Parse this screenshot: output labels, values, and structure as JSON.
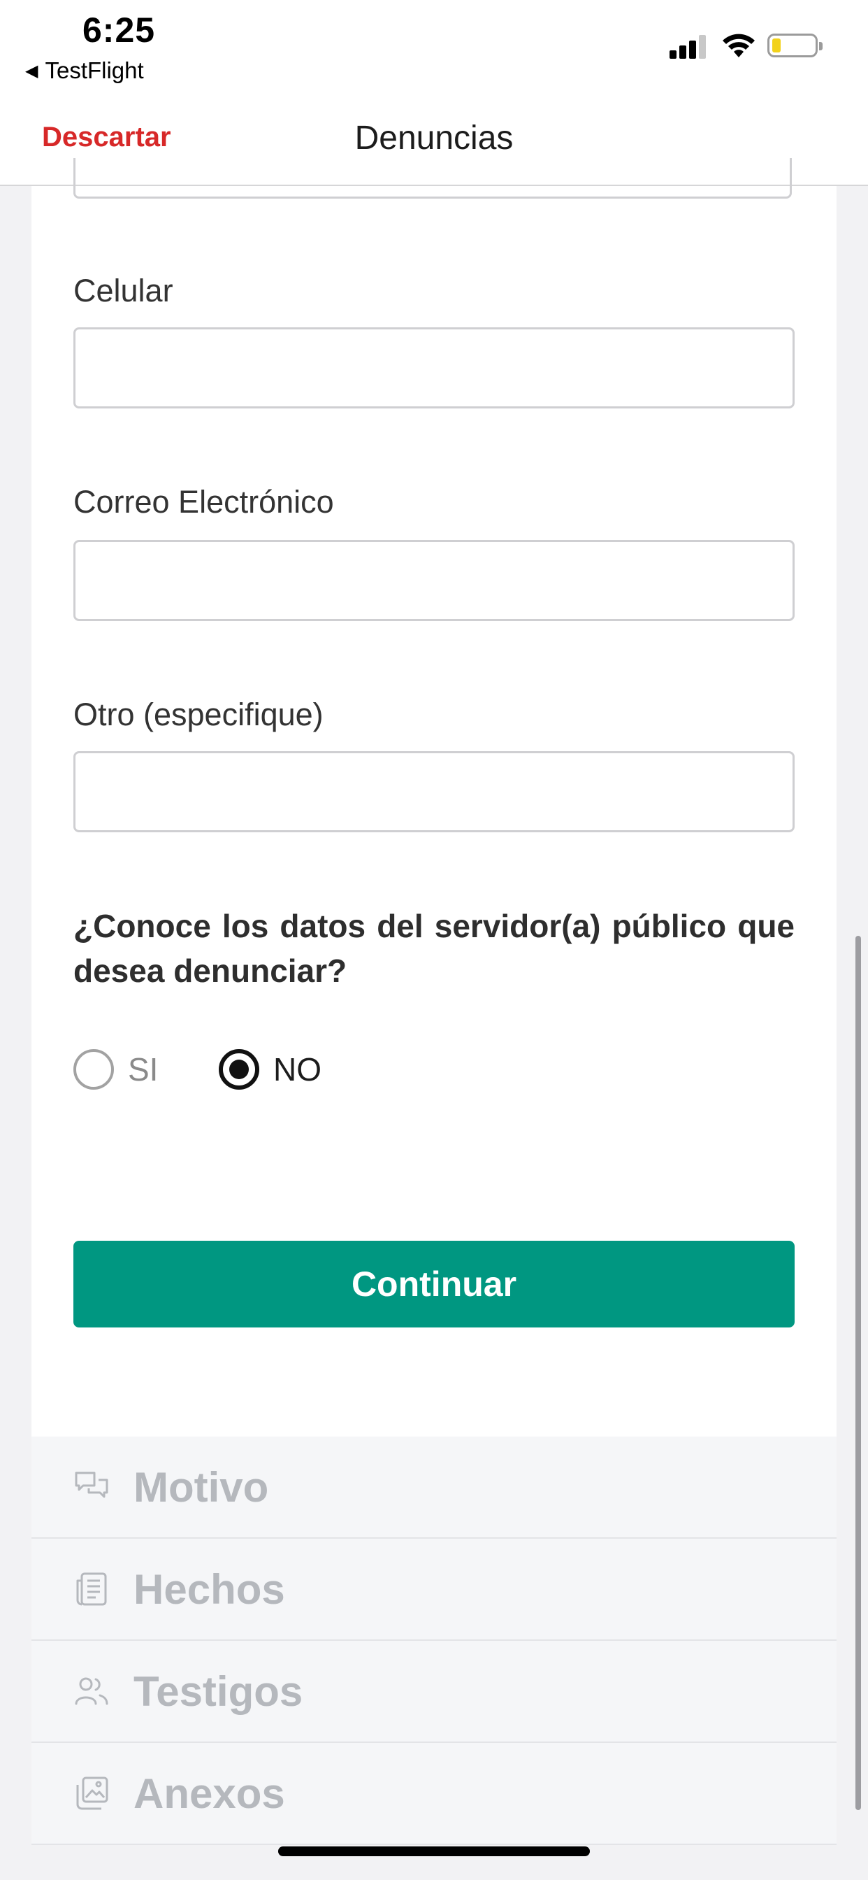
{
  "status_bar": {
    "time": "6:25",
    "back_app_label": "TestFlight",
    "icons": [
      "back-triangle-icon",
      "cellular-signal-icon",
      "wifi-icon",
      "battery-icon"
    ],
    "battery_level": 0.15,
    "battery_color": "#f2d21b"
  },
  "nav": {
    "discard_label": "Descartar",
    "title": "Denuncias"
  },
  "form": {
    "fields": [
      {
        "label": "Celular",
        "value": "",
        "placeholder": ""
      },
      {
        "label": "Correo Electrónico",
        "value": "",
        "placeholder": ""
      },
      {
        "label": "Otro (especifique)",
        "value": "",
        "placeholder": ""
      }
    ],
    "question": "¿Conoce los datos del servidor(a) público que desea denunciar?",
    "options": [
      {
        "label": "SI",
        "selected": false
      },
      {
        "label": "NO",
        "selected": true
      }
    ],
    "continue_label": "Continuar"
  },
  "sections": [
    {
      "label": "Motivo",
      "icon": "chat-bubbles-icon"
    },
    {
      "label": "Hechos",
      "icon": "document-list-icon"
    },
    {
      "label": "Testigos",
      "icon": "people-icon"
    },
    {
      "label": "Anexos",
      "icon": "images-icon"
    }
  ],
  "colors": {
    "accent": "#009781",
    "discard": "#d72828",
    "section_text": "#b5b8bd"
  }
}
